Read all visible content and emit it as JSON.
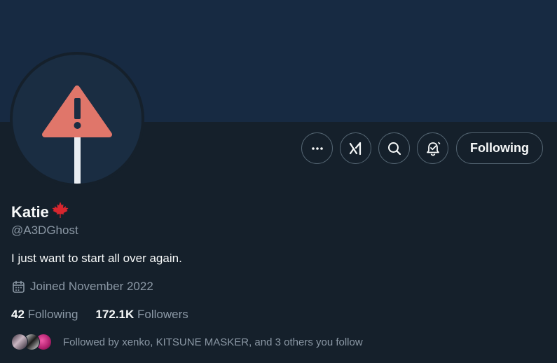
{
  "profile": {
    "display_name": "Katie",
    "name_emoji": "maple-leaf",
    "handle": "@A3DGhost",
    "bio": "I just want to start all over again.",
    "joined": "Joined November 2022",
    "following_count": "42",
    "following_label": "Following",
    "followers_count": "172.1K",
    "followers_label": "Followers",
    "followed_by": "Followed by xenko, KITSUNE MASKER, and 3 others you follow"
  },
  "actions": {
    "more_icon": "more-icon",
    "grok_icon": "grok-icon",
    "search_icon": "search-icon",
    "notify_icon": "bell-icon",
    "follow_button_label": "Following"
  },
  "colors": {
    "background": "#15202b",
    "banner": "#172a42",
    "text_primary": "#f7f9f9",
    "text_secondary": "#8b98a5",
    "border": "#536471",
    "warning_sign": "#e0766a"
  }
}
